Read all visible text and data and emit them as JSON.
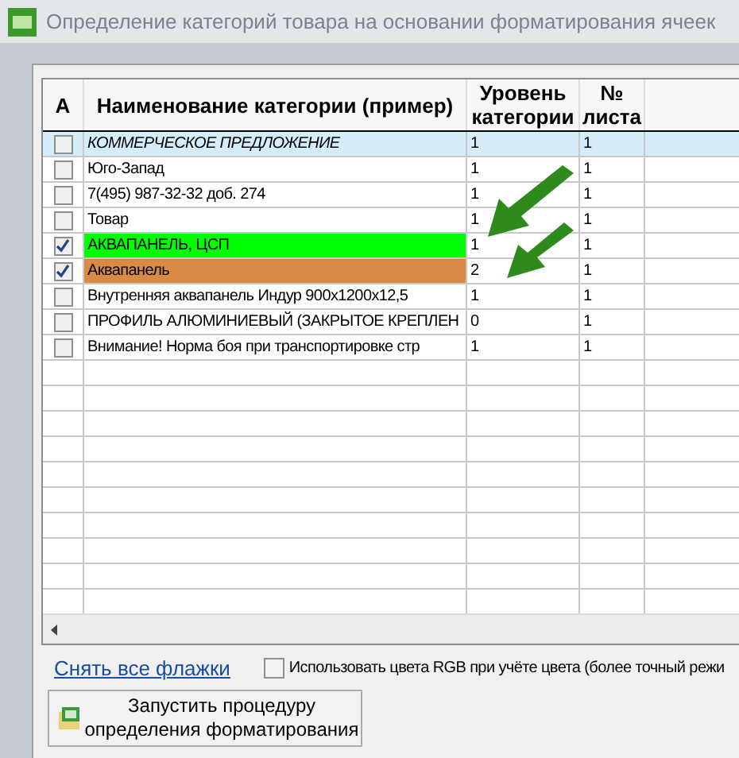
{
  "window": {
    "title": "Определение категорий товара на основании форматирования ячеек"
  },
  "table": {
    "columns": [
      "A",
      "Наименование категории (пример)",
      "Уровень категории",
      "№ листа"
    ],
    "rows": [
      {
        "checked": false,
        "selected": true,
        "italic": true,
        "name": "КОММЕРЧЕСКОЕ ПРЕДЛОЖЕНИЕ",
        "level": "1",
        "sheet": "1"
      },
      {
        "checked": false,
        "selected": false,
        "italic": false,
        "name": "Юго-Запад",
        "level": "1",
        "sheet": "1"
      },
      {
        "checked": false,
        "selected": false,
        "italic": false,
        "name": "7(495) 987-32-32 доб. 274",
        "level": "1",
        "sheet": "1"
      },
      {
        "checked": false,
        "selected": false,
        "italic": false,
        "name": "Товар",
        "level": "1",
        "sheet": "1"
      },
      {
        "checked": true,
        "selected": false,
        "italic": false,
        "name": "АКВАПАНЕЛЬ, ЦСП",
        "color": "#00ff00",
        "level": "1",
        "sheet": "1"
      },
      {
        "checked": true,
        "selected": false,
        "italic": false,
        "name": "Аквапанель",
        "color": "#d98b45",
        "level": "2",
        "sheet": "1"
      },
      {
        "checked": false,
        "selected": false,
        "italic": false,
        "name": "Внутренняя аквапанель Индур 900х1200х12,5",
        "level": "1",
        "sheet": "1"
      },
      {
        "checked": false,
        "selected": false,
        "italic": false,
        "name": "ПРОФИЛЬ АЛЮМИНИЕВЫЙ (ЗАКРЫТОЕ КРЕПЛЕН",
        "level": "0",
        "sheet": "1"
      },
      {
        "checked": false,
        "selected": false,
        "italic": false,
        "name": "Внимание! Норма боя при транспортировке стр",
        "level": "1",
        "sheet": "1"
      }
    ]
  },
  "clear_link": "Снять все флажки",
  "rgb_option": {
    "label": "Использовать цвета RGB при учёте цвета (более точный режи",
    "checked": false
  },
  "run_button": {
    "lines": [
      "Запустить процедуру",
      "определения форматирования"
    ]
  }
}
